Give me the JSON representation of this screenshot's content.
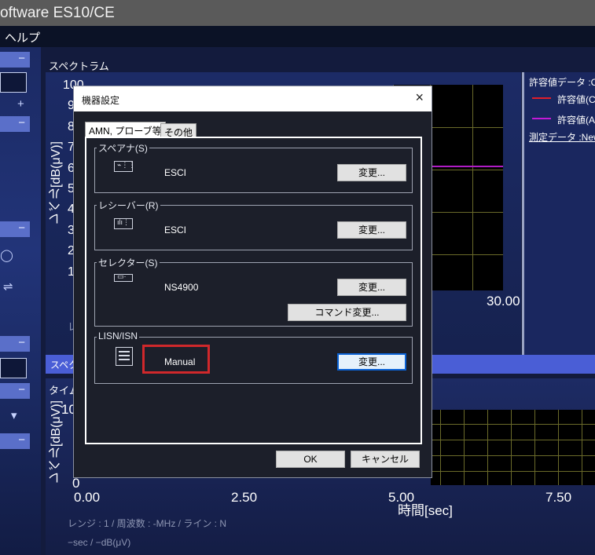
{
  "app": {
    "title": "oftware ES10/CE",
    "menu_item": "ヘルプ"
  },
  "spectrum": {
    "header": "スペクトラム",
    "y_ticks": [
      "100",
      "9",
      "8",
      "7",
      "6",
      "5",
      "4",
      "3",
      "2",
      "1"
    ],
    "y_label": "レベル[dB(μV)]",
    "x_end_label": "30.00",
    "footer_char": "レ",
    "right_panel": {
      "limit_data": "許容値データ :CI",
      "limit1": "許容値(C",
      "limit2": "許容値(A",
      "measured": "測定データ :New"
    },
    "colors": {
      "limit1": "#e01e2a",
      "limit2": "#c31ad6"
    }
  },
  "timebar": {
    "label": "スペク"
  },
  "time": {
    "header": "タイム",
    "y_label": "レベル[dB(μV)]",
    "y_tick_top": "10",
    "y_tick_bottom": "0",
    "x_ticks": [
      "0.00",
      "2.50",
      "5.00",
      "7.50"
    ],
    "x_label": "時間[sec]",
    "footer": "レンジ : 1 / 周波数 : -MHz / ライン : N",
    "units": "−sec / −dB(μV)"
  },
  "dialog": {
    "title": "機器設定",
    "close_icon": "×",
    "tabs": [
      "AMN, プローブ等",
      "その他"
    ],
    "groups": {
      "specana": {
        "label": "スペアナ(S)",
        "device": "ESCI",
        "change_label": "変更..."
      },
      "receiver": {
        "label": "レシーバー(R)",
        "device": "ESCI",
        "change_label": "変更..."
      },
      "selector": {
        "label": "セレクター(S)",
        "device": "NS4900",
        "change_label": "変更...",
        "command_label": "コマンド変更..."
      },
      "lisn": {
        "label": "LISN/ISN",
        "device": "Manual",
        "change_label": "変更..."
      }
    },
    "ok_label": "OK",
    "cancel_label": "キャンセル"
  }
}
